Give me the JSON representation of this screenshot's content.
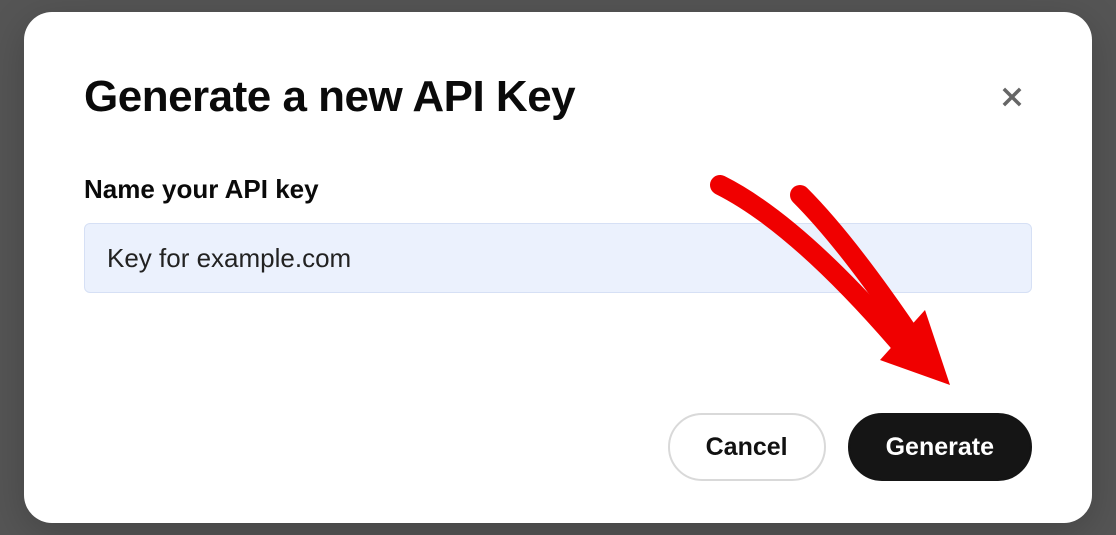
{
  "modal": {
    "title": "Generate a new API Key",
    "field_label": "Name your API key",
    "input_value": "Key for example.com",
    "cancel_label": "Cancel",
    "generate_label": "Generate"
  }
}
